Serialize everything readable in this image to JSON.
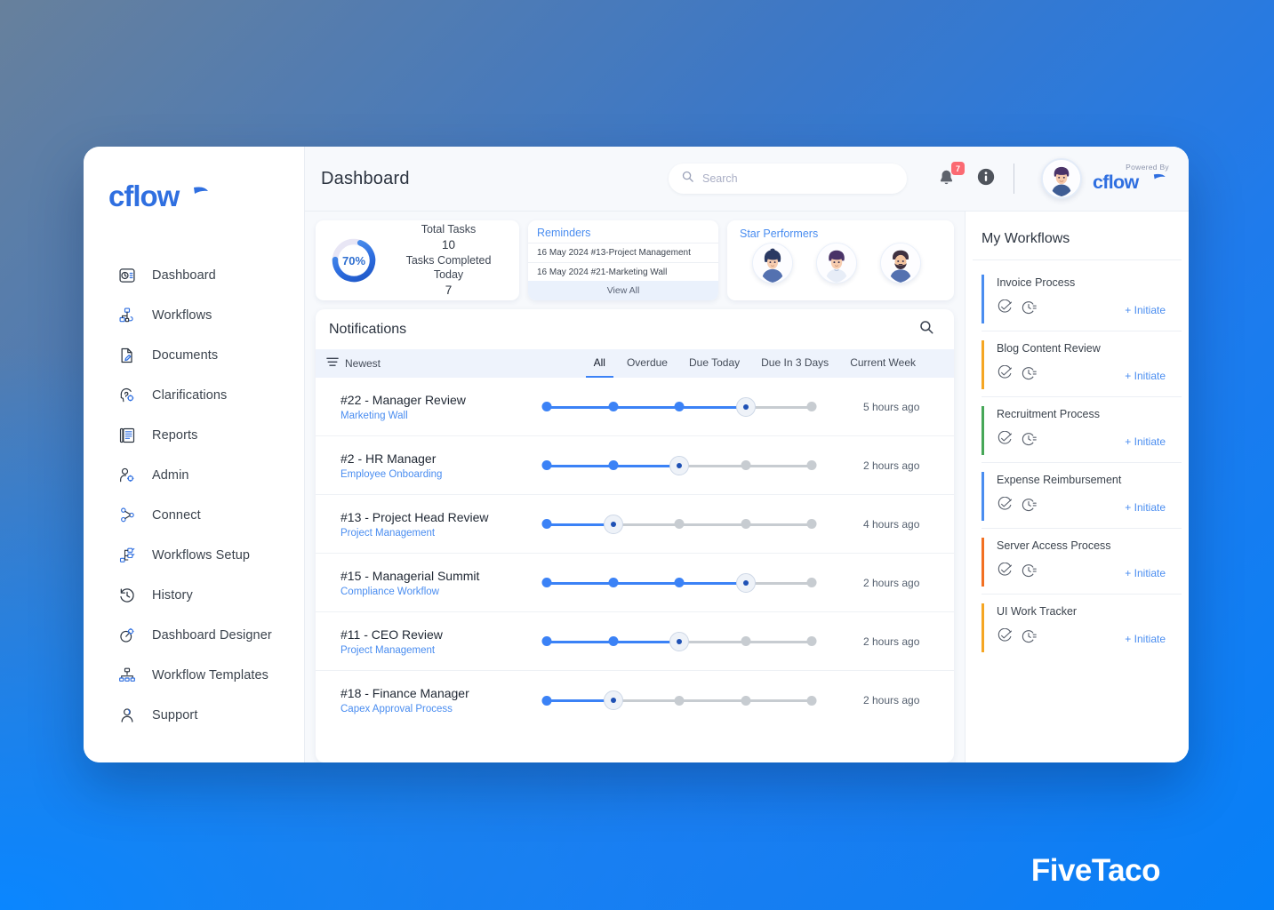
{
  "brand": {
    "logo_text": "cflow"
  },
  "sidebar": {
    "items": [
      {
        "label": "Dashboard",
        "icon": "dashboard-icon"
      },
      {
        "label": "Workflows",
        "icon": "workflows-icon"
      },
      {
        "label": "Documents",
        "icon": "documents-icon"
      },
      {
        "label": "Clarifications",
        "icon": "clarifications-icon"
      },
      {
        "label": "Reports",
        "icon": "reports-icon"
      },
      {
        "label": "Admin",
        "icon": "admin-icon"
      },
      {
        "label": "Connect",
        "icon": "connect-icon"
      },
      {
        "label": "Workflows Setup",
        "icon": "workflows-setup-icon"
      },
      {
        "label": "History",
        "icon": "history-icon"
      },
      {
        "label": "Dashboard Designer",
        "icon": "dashboard-designer-icon"
      },
      {
        "label": "Workflow Templates",
        "icon": "workflow-templates-icon"
      },
      {
        "label": "Support",
        "icon": "support-icon"
      }
    ]
  },
  "topbar": {
    "title": "Dashboard",
    "search_placeholder": "Search",
    "search_value": "",
    "notification_count": "7",
    "powered_by_label": "Powered By",
    "powered_by_brand": "cflow"
  },
  "cards": {
    "total_tasks": {
      "percent_label": "70%",
      "percent_value": 70,
      "total_tasks_label": "Total Tasks",
      "total_tasks_value": "10",
      "completed_label": "Tasks Completed Today",
      "completed_value": "7"
    },
    "reminders": {
      "title": "Reminders",
      "items": [
        "16 May 2024 #13-Project Management",
        "16 May 2024 #21-Marketing Wall"
      ],
      "view_all": "View All"
    },
    "star_performers": {
      "title": "Star Performers",
      "avatars": [
        "avatar-woman",
        "avatar-man",
        "avatar-bearded-man"
      ]
    }
  },
  "notifications": {
    "title": "Notifications",
    "sort_label": "Newest",
    "tabs": [
      {
        "label": "All",
        "active": true
      },
      {
        "label": "Overdue",
        "active": false
      },
      {
        "label": "Due Today",
        "active": false
      },
      {
        "label": "Due In 3 Days",
        "active": false
      },
      {
        "label": "Current Week",
        "active": false
      }
    ],
    "rows": [
      {
        "title": "#22 - Manager Review",
        "subtitle": "Marketing Wall",
        "time": "5 hours ago",
        "steps": 5,
        "current": 4
      },
      {
        "title": "#2 - HR Manager",
        "subtitle": "Employee Onboarding",
        "time": "2 hours ago",
        "steps": 5,
        "current": 3
      },
      {
        "title": "#13 - Project Head Review",
        "subtitle": "Project Management",
        "time": "4 hours ago",
        "steps": 5,
        "current": 2
      },
      {
        "title": "#15 - Managerial Summit",
        "subtitle": "Compliance Workflow",
        "time": "2 hours ago",
        "steps": 5,
        "current": 4
      },
      {
        "title": "#11 - CEO Review",
        "subtitle": "Project Management",
        "time": "2 hours ago",
        "steps": 5,
        "current": 3
      },
      {
        "title": "#18 - Finance Manager",
        "subtitle": "Capex Approval Process",
        "time": "2 hours ago",
        "steps": 5,
        "current": 2
      }
    ]
  },
  "my_workflows": {
    "title": "My Workflows",
    "initiate_label": "+ Initiate",
    "items": [
      {
        "name": "Invoice Process",
        "accent": "#4a8df0"
      },
      {
        "name": "Blog Content Review",
        "accent": "#f5a623"
      },
      {
        "name": "Recruitment Process",
        "accent": "#47a758"
      },
      {
        "name": "Expense Reimbursement",
        "accent": "#4a8df0"
      },
      {
        "name": "Server Access Process",
        "accent": "#f27022"
      },
      {
        "name": "UI Work Tracker",
        "accent": "#f5a623"
      }
    ]
  },
  "watermark": {
    "text": "FiveTaco"
  },
  "colors": {
    "accent_blue": "#3b82f6",
    "link_blue": "#4a8df0",
    "badge_red": "#fb6a72",
    "bg_blue": "#0680f8",
    "bg_slate": "#67809c"
  }
}
